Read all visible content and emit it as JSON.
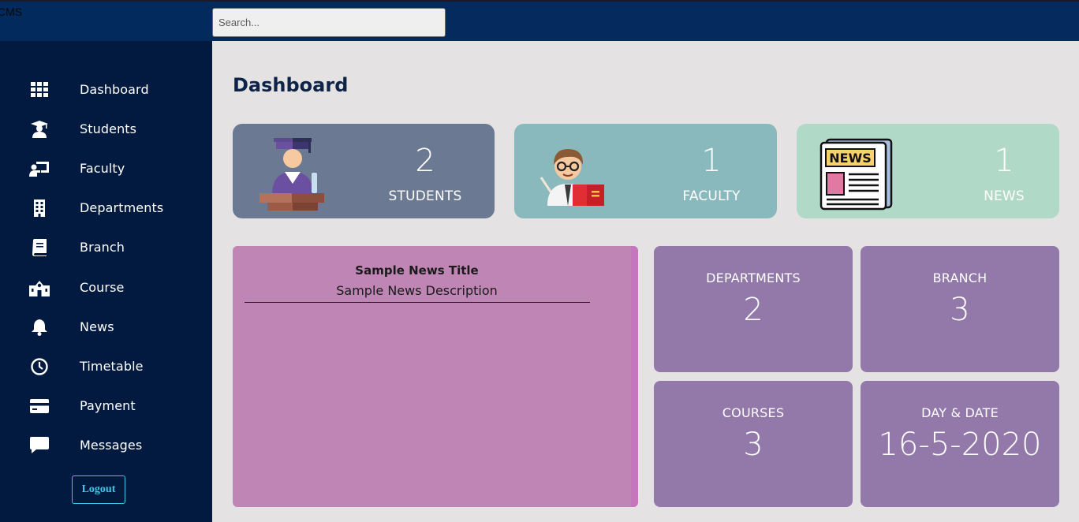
{
  "app": {
    "brand": "CMS"
  },
  "search": {
    "placeholder": "Search..."
  },
  "sidebar": {
    "items": [
      {
        "label": "Dashboard",
        "icon": "grid-icon"
      },
      {
        "label": "Students",
        "icon": "graduate-icon"
      },
      {
        "label": "Faculty",
        "icon": "teacher-board-icon"
      },
      {
        "label": "Departments",
        "icon": "building-icon"
      },
      {
        "label": "Branch",
        "icon": "book-icon"
      },
      {
        "label": "Course",
        "icon": "school-icon"
      },
      {
        "label": "News",
        "icon": "bell-icon"
      },
      {
        "label": "Timetable",
        "icon": "clock-icon"
      },
      {
        "label": "Payment",
        "icon": "credit-card-icon"
      },
      {
        "label": "Messages",
        "icon": "message-icon"
      }
    ],
    "logout_label": "Logout"
  },
  "main": {
    "title": "Dashboard",
    "cards": {
      "students": {
        "value": "2",
        "label": "STUDENTS",
        "icon": "graduate-podium-illustration"
      },
      "faculty": {
        "value": "1",
        "label": "FACULTY",
        "icon": "teacher-illustration"
      },
      "news": {
        "value": "1",
        "label": "NEWS",
        "icon": "newspaper-illustration"
      }
    },
    "news_panel": {
      "title": "Sample News Title",
      "description": "Sample News Description"
    },
    "tiles": {
      "departments": {
        "label": "DEPARTMENTS",
        "value": "2"
      },
      "branch": {
        "label": "BRANCH",
        "value": "3"
      },
      "courses": {
        "label": "COURSES",
        "value": "3"
      },
      "date": {
        "label": "DAY & DATE",
        "value": "16-5-2020"
      }
    }
  },
  "colors": {
    "topbar": "#052a5e",
    "sidebar": "#021a3f",
    "content_bg": "#e4e2e3",
    "students_card": "#6b7993",
    "faculty_card": "#89b9bc",
    "news_card": "#b1d9c7",
    "news_panel": "#bf86b5",
    "tiles": "#9279aa",
    "logout_accent": "#3fc6ea"
  }
}
